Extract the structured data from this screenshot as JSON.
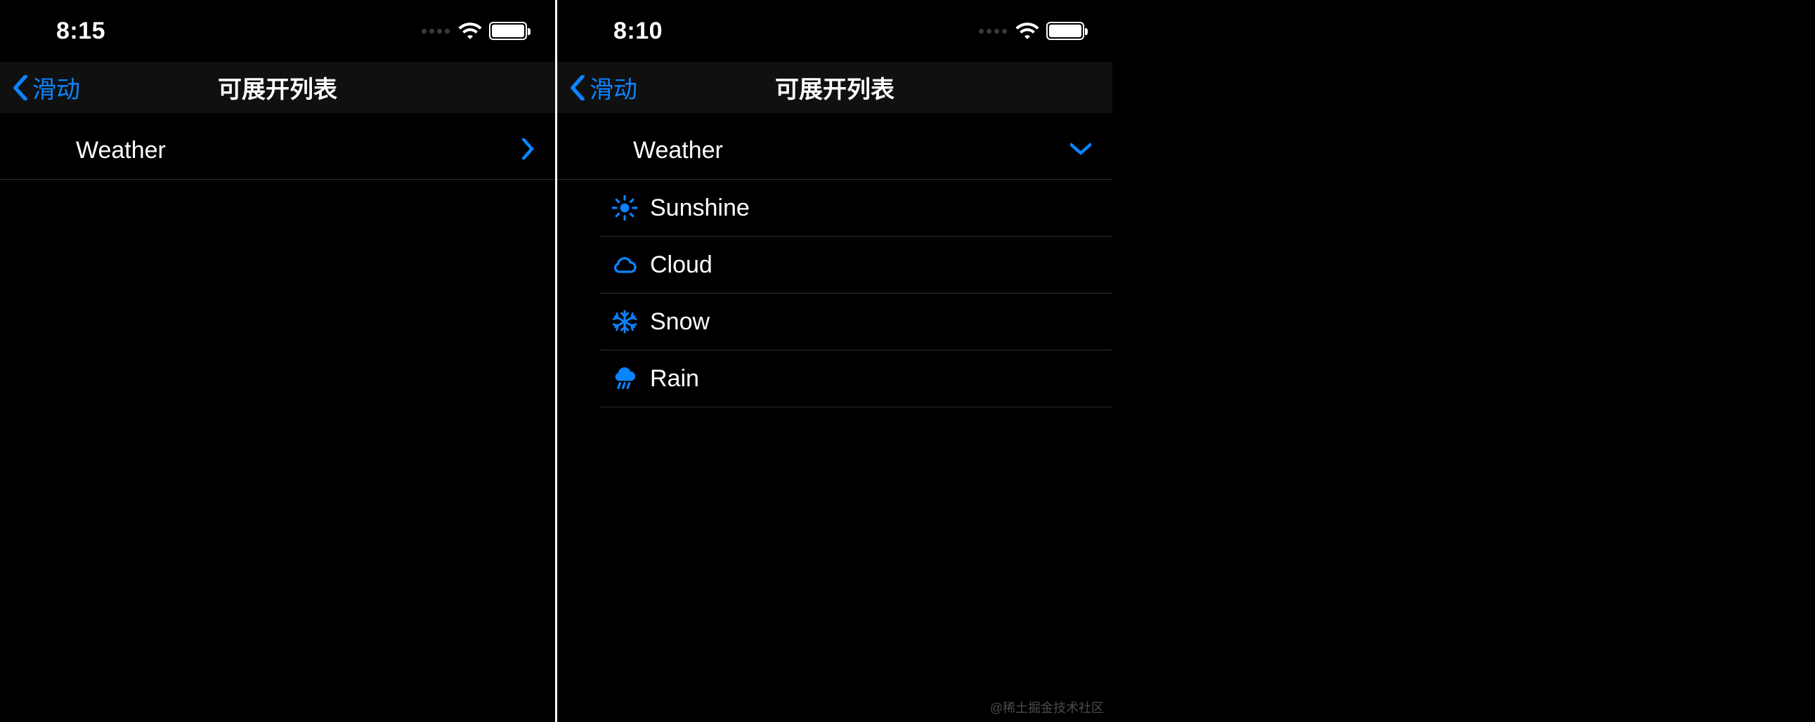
{
  "accent": "#0a84ff",
  "watermark": "@稀土掘金技术社区",
  "phones": [
    {
      "status": {
        "time": "8:15"
      },
      "nav": {
        "back_label": "滑动",
        "title": "可展开列表"
      },
      "group": {
        "title": "Weather",
        "expanded": false
      }
    },
    {
      "status": {
        "time": "8:10"
      },
      "nav": {
        "back_label": "滑动",
        "title": "可展开列表"
      },
      "group": {
        "title": "Weather",
        "expanded": true,
        "items": [
          {
            "icon": "sun-icon",
            "label": "Sunshine"
          },
          {
            "icon": "cloud-icon",
            "label": "Cloud"
          },
          {
            "icon": "snowflake-icon",
            "label": "Snow"
          },
          {
            "icon": "rain-icon",
            "label": "Rain"
          }
        ]
      }
    }
  ]
}
